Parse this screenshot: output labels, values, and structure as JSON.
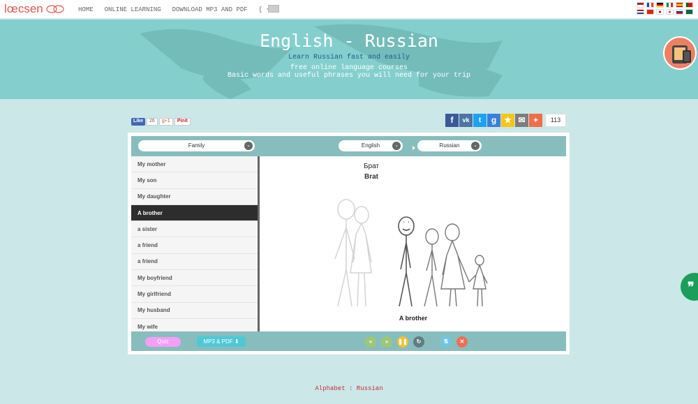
{
  "brand": {
    "logo_text": "lœcsen"
  },
  "nav": {
    "items": [
      "HOME",
      "ONLINE LEARNING",
      "DOWNLOAD MP3 AND PDF",
      "[ + ]"
    ]
  },
  "flags": [
    "us",
    "fr",
    "de",
    "it",
    "es",
    "pt",
    "nl",
    "cn",
    "jp",
    "kr",
    "ru",
    "sa"
  ],
  "hero": {
    "title": "English - Russian",
    "subtitle": "Learn Russian fast and easily",
    "line1": "free online language courses",
    "line2": "Basic words and useful phrases you will need for your trip"
  },
  "social": {
    "like_label": "Like",
    "like_count": "26",
    "gplus_label": "g+1",
    "pinit_label": "Pinit",
    "share_count": "113"
  },
  "widget": {
    "category": "Family",
    "from_language": "English",
    "to_language": "Russian",
    "list": [
      "My mother",
      "My son",
      "My daughter",
      "A brother",
      "a sister",
      "a friend",
      "a friend",
      "My boyfriend",
      "My girlfriend",
      "My husband",
      "My wife"
    ],
    "active_index": 3,
    "word_native": "Брат",
    "word_translit": "Brat",
    "caption": "A brother",
    "quiz_label": "Quiz",
    "mp3_label": "MP3 & PDF"
  },
  "footer": {
    "link": "Alphabet : Russian"
  },
  "colors": {
    "accent": "#88bdbd",
    "hero": "#84cfcd",
    "page": "#cbe7e8",
    "active": "#2d2d2d"
  }
}
